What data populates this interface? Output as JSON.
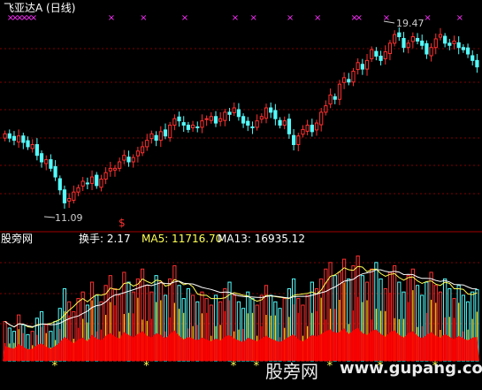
{
  "title": "飞亚达A (日线)",
  "logo": "股旁网",
  "watermark_cn": "股旁网",
  "watermark_url": "www.gupang.com",
  "high_label": "19.47",
  "low_label": "11.09",
  "signal_mark": "$",
  "vol_label": "换手: 2.17",
  "ma5_label": "MA5: 11716.70",
  "ma13_label": "MA13: 16935.12",
  "colors": {
    "up": "#ff3030",
    "down": "#54fcfc",
    "ma_white": "#ffffff",
    "ma_yellow": "#ffff54",
    "star": "#ffff54",
    "magenta": "#ff30ff",
    "grid": "#800000",
    "vol_fill_yellow": "#ffd700",
    "vol_fill_red": "#ff0000"
  },
  "chart_data": {
    "type": "candlestick+volume",
    "price_range": [
      11.09,
      19.47
    ],
    "closes": [
      14.6,
      14.4,
      14.3,
      14.5,
      14.2,
      14.0,
      14.1,
      13.6,
      13.3,
      13.4,
      13.0,
      12.6,
      12.0,
      11.4,
      11.6,
      11.9,
      12.1,
      12.4,
      12.3,
      12.6,
      12.2,
      12.5,
      12.8,
      13.0,
      13.0,
      13.3,
      13.6,
      13.3,
      13.5,
      13.8,
      14.0,
      14.3,
      14.6,
      14.3,
      14.7,
      14.5,
      15.0,
      15.3,
      15.2,
      15.0,
      14.8,
      15.0,
      14.9,
      15.2,
      15.3,
      15.4,
      15.1,
      15.3,
      15.6,
      15.5,
      15.8,
      15.4,
      15.1,
      15.0,
      14.9,
      15.2,
      15.4,
      15.8,
      15.6,
      15.3,
      15.0,
      15.2,
      14.6,
      14.1,
      14.5,
      14.8,
      15.0,
      14.7,
      15.1,
      15.6,
      15.9,
      16.4,
      16.2,
      16.9,
      17.2,
      17.0,
      17.5,
      17.9,
      17.6,
      18.0,
      18.5,
      18.2,
      18.0,
      18.4,
      18.8,
      19.2,
      19.1,
      18.6,
      18.8,
      19.1,
      18.9,
      18.7,
      18.3,
      18.6,
      19.0,
      19.2,
      18.8,
      18.7,
      18.9,
      18.6,
      18.5,
      18.3,
      18.0,
      17.7
    ],
    "turnover": [
      1.2,
      1.0,
      0.9,
      1.4,
      1.1,
      0.8,
      0.9,
      1.3,
      1.5,
      1.1,
      0.9,
      1.2,
      1.6,
      2.2,
      1.8,
      1.5,
      1.9,
      2.1,
      1.7,
      2.4,
      2.0,
      1.8,
      2.3,
      2.6,
      2.2,
      2.0,
      2.7,
      2.4,
      2.1,
      2.5,
      2.8,
      2.3,
      2.1,
      2.6,
      2.4,
      2.0,
      2.5,
      2.9,
      2.3,
      1.9,
      2.2,
      2.0,
      1.8,
      2.1,
      1.9,
      1.7,
      2.0,
      1.8,
      2.2,
      2.4,
      2.0,
      1.8,
      1.6,
      2.1,
      1.9,
      1.7,
      2.0,
      2.3,
      2.0,
      1.8,
      1.6,
      1.9,
      2.2,
      2.5,
      1.9,
      1.7,
      2.0,
      2.4,
      2.2,
      2.5,
      2.8,
      3.0,
      2.6,
      2.7,
      3.1,
      2.5,
      2.9,
      3.2,
      2.6,
      2.4,
      2.8,
      3.0,
      2.5,
      2.2,
      2.7,
      2.9,
      2.4,
      2.1,
      2.6,
      2.8,
      2.3,
      2.0,
      2.4,
      2.7,
      2.3,
      2.1,
      2.5,
      2.2,
      1.9,
      2.3,
      2.0,
      1.8,
      2.1,
      2.17
    ],
    "stars_at": [
      11,
      31,
      50,
      55,
      71,
      82,
      94,
      111
    ],
    "magenta_top_at": [
      1,
      2,
      3,
      4,
      5,
      6,
      23,
      30,
      39,
      50,
      54,
      62,
      68,
      76,
      77,
      83,
      92,
      99,
      105
    ]
  }
}
